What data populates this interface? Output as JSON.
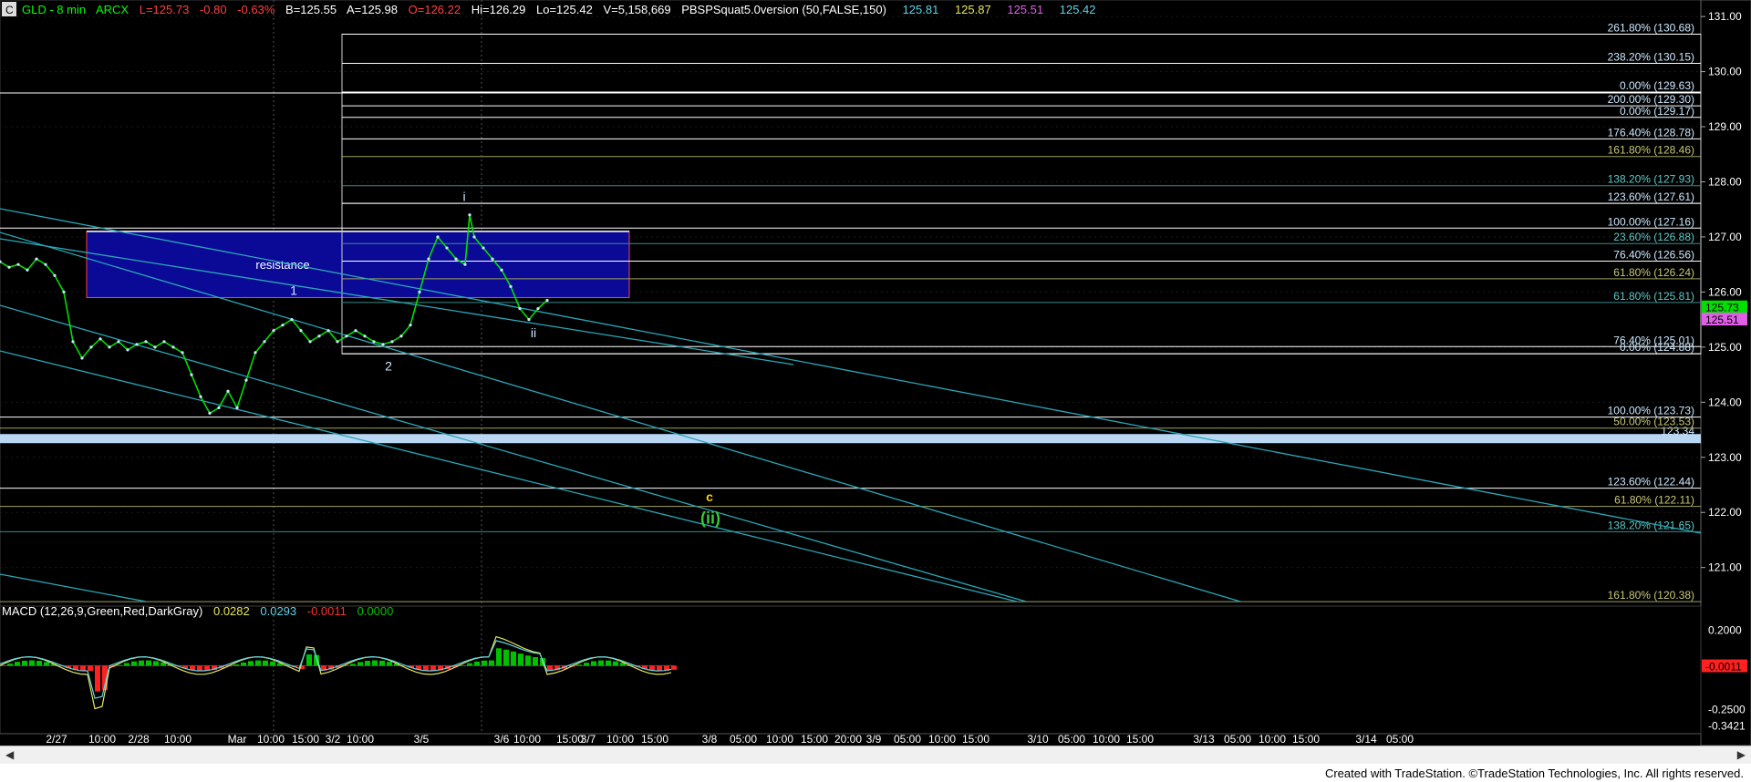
{
  "header": {
    "symbol": "GLD - 8 min",
    "exchange": "ARCX",
    "last": "L=125.73",
    "change": "-0.80",
    "pct": "-0.63%",
    "bid": "B=125.55",
    "ask": "A=125.98",
    "open": "O=126.22",
    "high": "Hi=126.29",
    "low": "Lo=125.42",
    "volume": "V=5,158,669",
    "study": "PBSPSquat5.0version (50,FALSE,150)",
    "study_vals": [
      "125.81",
      "125.87",
      "125.51",
      "125.42"
    ],
    "study_colors": [
      "#5fd3e6",
      "#e6e65f",
      "#e05fe6",
      "#5fd3e6"
    ],
    "icon": "C"
  },
  "macd": {
    "label": "MACD (12,26,9,Green,Red,DarkGray)",
    "vals": [
      "0.0282",
      "0.0293",
      "-0.0011",
      "0.0000"
    ],
    "val_colors": [
      "#e6e65f",
      "#5fd3e6",
      "#ff3030",
      "#00c000"
    ],
    "current": "-0.0011"
  },
  "footer": {
    "credit": "Created with TradeStation. ©TradeStation Technologies, Inc. All rights reserved."
  },
  "chart_data": {
    "type": "line",
    "title": "GLD - 8 min",
    "ylim": [
      120.3,
      131.3
    ],
    "y_ticks": [
      121.0,
      122.0,
      123.0,
      124.0,
      125.0,
      126.0,
      127.0,
      128.0,
      129.0,
      130.0,
      131.0
    ],
    "y_tick_labels": [
      "121.00",
      "122.00",
      "123.00",
      "124.00",
      "125.00",
      "126.00",
      "127.00",
      "128.00",
      "129.00",
      "130.00",
      "131.00"
    ],
    "x_tick_labels": [
      "2/27",
      "10:00",
      "2/28",
      "10:00",
      "Mar",
      "10:00",
      "15:00",
      "3/2",
      "10:00",
      "3/5",
      "3/6",
      "10:00",
      "15:00",
      "3/7",
      "10:00",
      "15:00",
      "3/8",
      "05:00",
      "10:00",
      "15:00",
      "20:00",
      "3/9",
      "05:00",
      "10:00",
      "15:00",
      "3/10",
      "05:00",
      "10:00",
      "15:00",
      "3/13",
      "05:00",
      "10:00",
      "15:00",
      "3/14",
      "05:00"
    ],
    "price_series": [
      [
        0,
        126.55
      ],
      [
        10,
        126.45
      ],
      [
        20,
        126.5
      ],
      [
        30,
        126.4
      ],
      [
        40,
        126.6
      ],
      [
        50,
        126.5
      ],
      [
        60,
        126.3
      ],
      [
        70,
        126.0
      ],
      [
        80,
        125.1
      ],
      [
        90,
        124.8
      ],
      [
        100,
        125.0
      ],
      [
        110,
        125.15
      ],
      [
        120,
        125.0
      ],
      [
        130,
        125.1
      ],
      [
        140,
        124.95
      ],
      [
        150,
        125.05
      ],
      [
        160,
        125.1
      ],
      [
        170,
        125.0
      ],
      [
        180,
        125.1
      ],
      [
        190,
        125.0
      ],
      [
        200,
        124.9
      ],
      [
        210,
        124.5
      ],
      [
        220,
        124.1
      ],
      [
        230,
        123.8
      ],
      [
        240,
        123.9
      ],
      [
        250,
        124.2
      ],
      [
        260,
        123.9
      ],
      [
        270,
        124.4
      ],
      [
        280,
        124.9
      ],
      [
        290,
        125.1
      ],
      [
        300,
        125.3
      ],
      [
        310,
        125.4
      ],
      [
        320,
        125.5
      ],
      [
        330,
        125.3
      ],
      [
        340,
        125.1
      ],
      [
        350,
        125.2
      ],
      [
        360,
        125.3
      ],
      [
        370,
        125.1
      ],
      [
        380,
        125.2
      ],
      [
        390,
        125.3
      ],
      [
        400,
        125.2
      ],
      [
        410,
        125.1
      ],
      [
        420,
        125.05
      ],
      [
        430,
        125.1
      ],
      [
        440,
        125.2
      ],
      [
        450,
        125.4
      ],
      [
        460,
        126.0
      ],
      [
        470,
        126.6
      ],
      [
        480,
        127.0
      ],
      [
        490,
        126.8
      ],
      [
        500,
        126.6
      ],
      [
        510,
        126.5
      ],
      [
        515,
        127.4
      ],
      [
        520,
        127.0
      ],
      [
        530,
        126.8
      ],
      [
        540,
        126.6
      ],
      [
        550,
        126.4
      ],
      [
        560,
        126.1
      ],
      [
        570,
        125.7
      ],
      [
        580,
        125.5
      ],
      [
        590,
        125.7
      ],
      [
        600,
        125.85
      ]
    ],
    "current_price": "125.73",
    "price_tags": [
      {
        "value": "125.73",
        "color": "#00e000",
        "y": 125.73
      },
      {
        "value": "125.51",
        "color": "#e05fe6",
        "y": 125.51
      }
    ],
    "fib_levels": [
      {
        "label": "261.80% (130.68)",
        "y": 130.68,
        "color": "#ffffff",
        "text_color": "#cce8ff"
      },
      {
        "label": "238.20% (130.15)",
        "y": 130.15,
        "color": "#ffffff",
        "text_color": "#cce8ff"
      },
      {
        "label": "0.00% (129.63)",
        "y": 129.63,
        "color": "#ffffff",
        "text_color": "#cce8ff"
      },
      {
        "label": "200.00% (129.30)",
        "y": 129.38,
        "color": "#ffffff",
        "text_color": "#cce8ff"
      },
      {
        "label": "0.00% (129.17)",
        "y": 129.17,
        "color": "#ffffff",
        "text_color": "#cce8ff"
      },
      {
        "label": "176.40% (128.78)",
        "y": 128.78,
        "color": "#ffffff",
        "text_color": "#cce8ff"
      },
      {
        "label": "161.80% (128.46)",
        "y": 128.46,
        "color": "#a0a060",
        "text_color": "#c8c878"
      },
      {
        "label": "138.20% (127.93)",
        "y": 127.93,
        "color": "#3a8a8a",
        "text_color": "#5fc8c8"
      },
      {
        "label": "123.60% (127.61)",
        "y": 127.61,
        "color": "#ffffff",
        "text_color": "#cce8ff"
      },
      {
        "label": "100.00% (127.16)",
        "y": 127.16,
        "color": "#ffffff",
        "text_color": "#cce8ff"
      },
      {
        "label": "23.60% (126.88)",
        "y": 126.88,
        "color": "#3a8a8a",
        "text_color": "#5fc8c8"
      },
      {
        "label": "76.40% (126.56)",
        "y": 126.56,
        "color": "#ffffff",
        "text_color": "#cce8ff"
      },
      {
        "label": "61.80% (126.24)",
        "y": 126.24,
        "color": "#a0a060",
        "text_color": "#c8c878"
      },
      {
        "label": "61.80% (125.81)",
        "y": 125.81,
        "color": "#3a8a8a",
        "text_color": "#5fc8c8"
      },
      {
        "label": "76.40% (125.01)",
        "y": 125.01,
        "color": "#ffffff",
        "text_color": "#cce8ff"
      },
      {
        "label": "0.00% (124.88)",
        "y": 124.88,
        "color": "#ffffff",
        "text_color": "#cce8ff"
      },
      {
        "label": "100.00% (123.73)",
        "y": 123.73,
        "color": "#ffffff",
        "text_color": "#cce8ff"
      },
      {
        "label": "50.00% (123.53)",
        "y": 123.53,
        "color": "#a0a060",
        "text_color": "#c8c878"
      },
      {
        "label": "123.60% (122.44)",
        "y": 122.44,
        "color": "#ffffff",
        "text_color": "#cce8ff"
      },
      {
        "label": "61.80% (122.11)",
        "y": 122.11,
        "color": "#a0a060",
        "text_color": "#c8c878"
      },
      {
        "label": "138.20% (121.65)",
        "y": 121.65,
        "color": "#3a8a8a",
        "text_color": "#5fc8c8"
      },
      {
        "label": "161.80% (120.38)",
        "y": 120.38,
        "color": "#a0a060",
        "text_color": "#c8c878"
      }
    ],
    "support_band": {
      "y": 123.34,
      "label": "123.34"
    },
    "resistance": {
      "label": "resistance",
      "y_top": 127.1,
      "y_bottom": 125.9
    },
    "wave_labels": [
      {
        "text": "1",
        "x": 322,
        "y": 125.95,
        "color": "#cfe6ff"
      },
      {
        "text": "2",
        "x": 426,
        "y": 124.58,
        "color": "#cfe6ff"
      },
      {
        "text": "i",
        "x": 509,
        "y": 127.65,
        "color": "#cfe6ff"
      },
      {
        "text": "ii",
        "x": 585,
        "y": 125.18,
        "color": "#cfe6ff"
      },
      {
        "text": "c",
        "x": 778,
        "y": 122.2,
        "color": "#ffd000"
      },
      {
        "text": "(ii)",
        "x": 779,
        "y": 121.8,
        "color": "#33cc33"
      }
    ],
    "macd_ylim": [
      -0.36,
      0.26
    ],
    "macd_ticks": [
      0.2,
      -0.25,
      -0.3421
    ],
    "macd_tick_labels": [
      "0.2000",
      "-0.2500",
      "-0.3421"
    ]
  }
}
